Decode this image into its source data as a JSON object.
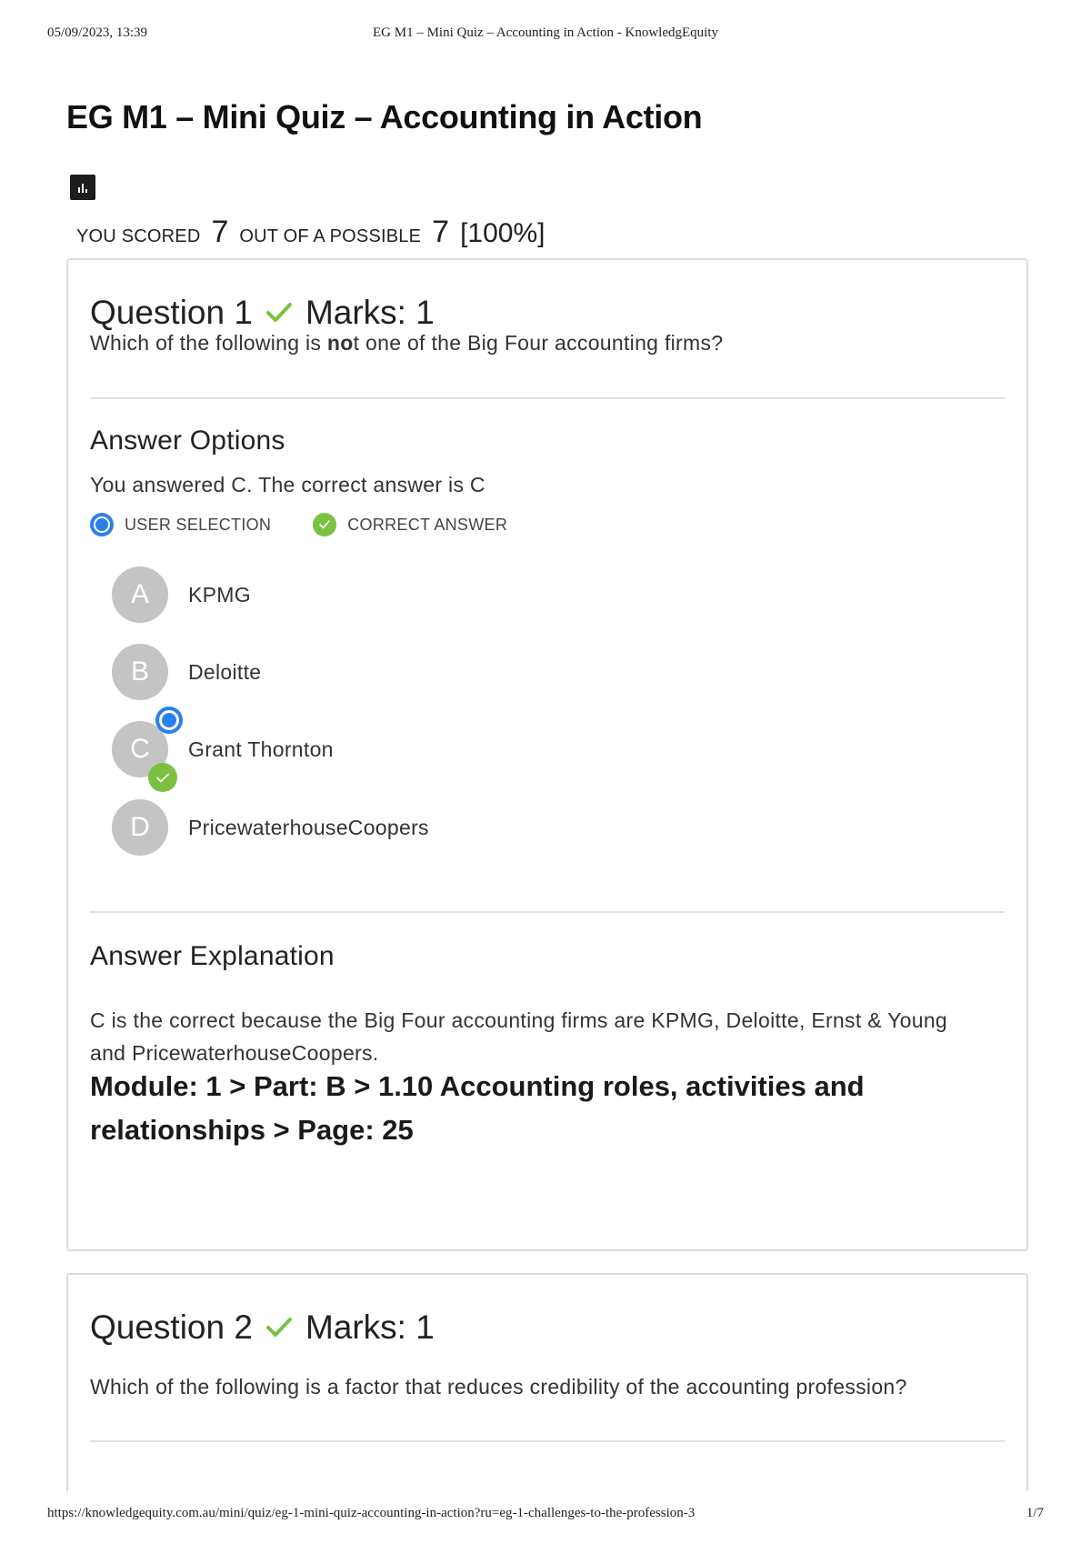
{
  "print_header": {
    "date": "05/09/2023, 13:39",
    "title": "EG M1 – Mini Quiz – Accounting in Action - KnowledgEquity"
  },
  "print_footer": {
    "url": "https://knowledgequity.com.au/mini/quiz/eg-1-mini-quiz-accounting-in-action?ru=eg-1-challenges-to-the-profession-3",
    "page": "1/7"
  },
  "page": {
    "title": "EG M1 – Mini Quiz – Accounting in Action",
    "report_icon": "bar-chart-icon"
  },
  "score": {
    "label_scored": "YOU SCORED",
    "scored": "7",
    "label_possible": "OUT OF A POSSIBLE",
    "possible": "7",
    "percent": "[100%]"
  },
  "questions": [
    {
      "title": "Question 1",
      "marks": "Marks: 1",
      "text_before": "Which of the following is ",
      "text_bold": "no",
      "text_after": "t one of the Big Four accounting firms?",
      "answer_options_title": "Answer Options",
      "answered_text": "You answered C. The correct answer is C",
      "legend": {
        "user_selection": "USER SELECTION",
        "correct_answer": "CORRECT ANSWER"
      },
      "options": [
        {
          "letter": "A",
          "label": "KPMG"
        },
        {
          "letter": "B",
          "label": "Deloitte"
        },
        {
          "letter": "C",
          "label": "Grant Thornton"
        },
        {
          "letter": "D",
          "label": "PricewaterhouseCoopers"
        }
      ],
      "explanation_title": "Answer Explanation",
      "explanation": "C is the correct because the Big Four accounting firms are KPMG, Deloitte, Ernst & Young and PricewaterhouseCoopers.",
      "module_ref": "Module: 1 > Part: B > 1.10 Accounting roles, activities and relationships > Page: 25"
    },
    {
      "title": "Question 2",
      "marks": "Marks: 1",
      "text": "Which of the following is a factor that reduces credibility of the accounting profession?"
    }
  ],
  "colors": {
    "user_selection": "#2a7ff0",
    "correct": "#7ac142",
    "option_circle": "#c4c4c4"
  }
}
